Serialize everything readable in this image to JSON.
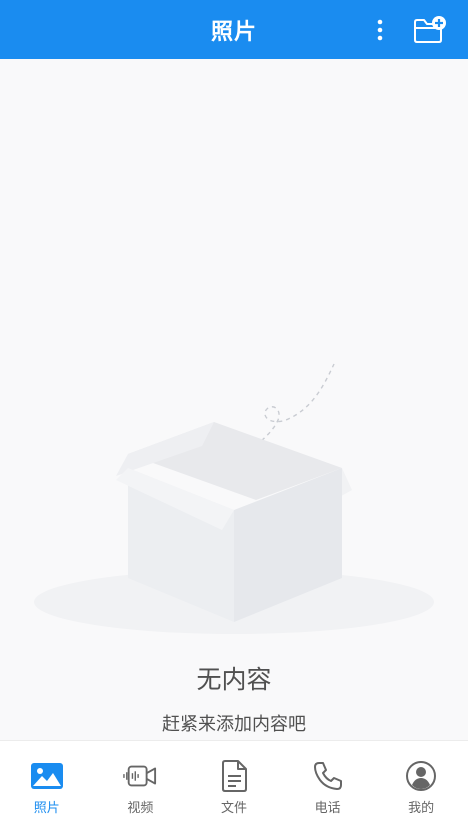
{
  "header": {
    "title": "照片",
    "more_icon": "more-vertical-icon",
    "add_folder_icon": "folder-plus-icon"
  },
  "empty_state": {
    "title": "无内容",
    "subtitle": "赶紧来添加内容吧",
    "illustration": "empty-open-box"
  },
  "bottom_nav": {
    "items": [
      {
        "label": "照片",
        "icon": "photo-icon",
        "active": true
      },
      {
        "label": "视频",
        "icon": "video-icon",
        "active": false
      },
      {
        "label": "文件",
        "icon": "file-icon",
        "active": false
      },
      {
        "label": "电话",
        "icon": "phone-icon",
        "active": false
      },
      {
        "label": "我的",
        "icon": "user-icon",
        "active": false
      }
    ]
  },
  "colors": {
    "primary": "#1a8cf0",
    "background": "#f9f9fa",
    "text": "#505050",
    "inactive": "#666666"
  }
}
